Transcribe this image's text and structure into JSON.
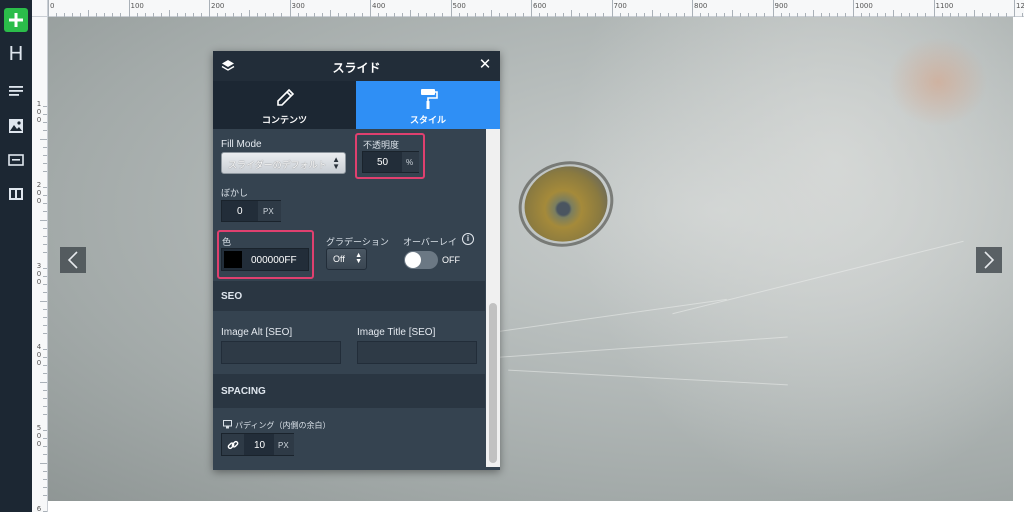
{
  "toolbar": {
    "add_icon": "plus-icon",
    "heading_label": "H",
    "items": [
      "heading-icon",
      "text-icon",
      "image-icon",
      "button-icon",
      "columns-icon"
    ]
  },
  "ruler": {
    "top_ticks": [
      "0",
      "100",
      "200",
      "300",
      "400",
      "500",
      "600",
      "700",
      "800",
      "900",
      "1000",
      "1100",
      "12"
    ],
    "left_ticks": [
      [
        "1",
        "0",
        "0"
      ],
      [
        "2",
        "0",
        "0"
      ],
      [
        "3",
        "0",
        "0"
      ],
      [
        "4",
        "0",
        "0"
      ],
      [
        "5",
        "0",
        "0"
      ],
      [
        "6"
      ]
    ]
  },
  "panel": {
    "title": "スライド",
    "close_icon": "close-icon",
    "tabs": [
      {
        "label": "コンテンツ",
        "icon": "pencil-icon",
        "active": false
      },
      {
        "label": "スタイル",
        "icon": "paint-roller-icon",
        "active": true
      }
    ],
    "fill_mode": {
      "label": "Fill Mode",
      "value": "スライダーのデフォルト"
    },
    "opacity": {
      "label": "不透明度",
      "value": "50",
      "unit": "%"
    },
    "blur": {
      "label": "ぼかし",
      "value": "0",
      "unit": "PX"
    },
    "color": {
      "label": "色",
      "value": "000000FF",
      "swatch": "#000000"
    },
    "gradient": {
      "label": "グラデーション",
      "value": "Off"
    },
    "overlay": {
      "label": "オーバーレイ",
      "state": "OFF",
      "info_icon": "info-icon"
    },
    "seo": {
      "section": "SEO",
      "image_alt_label": "Image Alt [SEO]",
      "image_alt_value": "",
      "image_title_label": "Image Title [SEO]",
      "image_title_value": ""
    },
    "spacing": {
      "section": "SPACING",
      "padding_label": "パディング（内側の余白）",
      "padding_value": "10",
      "padding_unit": "PX"
    }
  },
  "colors": {
    "accent": "#2f8ff5",
    "highlight": "#e0406f",
    "add_button": "#2bbd4a"
  }
}
